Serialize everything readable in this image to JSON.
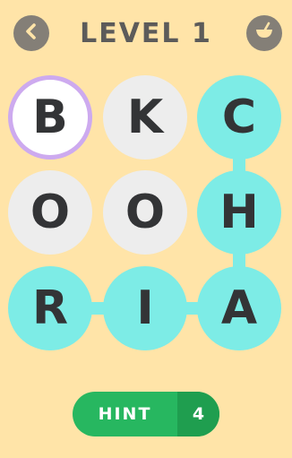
{
  "header": {
    "title": "LEVEL 1",
    "back_icon": "chevron-left-icon",
    "shop_icon": "basket-icon"
  },
  "colors": {
    "background": "#FFE4A8",
    "tile_plain": "#EDEDED",
    "tile_active": "#7DECE6",
    "tile_selected_ring": "#CDAAEF",
    "text": "#333436",
    "hint_green": "#27B760",
    "hint_green_dark": "#1F9E4F",
    "button_gray": "#847F77"
  },
  "board": {
    "rows": [
      [
        {
          "letter": "B",
          "state": "selected"
        },
        {
          "letter": "K",
          "state": "plain"
        },
        {
          "letter": "C",
          "state": "active"
        }
      ],
      [
        {
          "letter": "O",
          "state": "plain"
        },
        {
          "letter": "O",
          "state": "plain"
        },
        {
          "letter": "H",
          "state": "active"
        }
      ],
      [
        {
          "letter": "R",
          "state": "active"
        },
        {
          "letter": "I",
          "state": "active"
        },
        {
          "letter": "A",
          "state": "active"
        }
      ]
    ]
  },
  "hint": {
    "label": "HINT",
    "count": "4"
  }
}
